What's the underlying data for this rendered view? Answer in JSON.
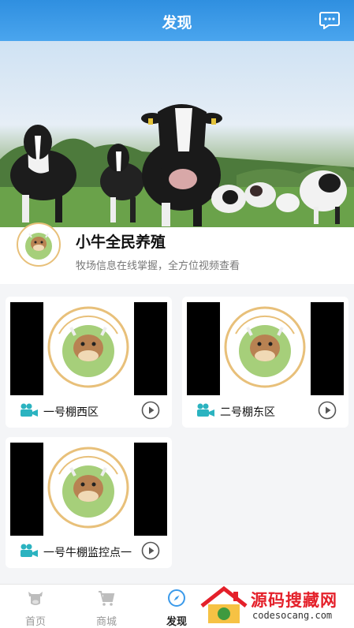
{
  "header": {
    "title": "发现",
    "chat_icon": "chat-bubble-icon",
    "color": "#3b9aea"
  },
  "profile": {
    "name": "小牛全民养殖",
    "description": "牧场信息在线掌握，全方位视频查看",
    "avatar_logo_text": "CALVES GROW FAST"
  },
  "cameras": [
    {
      "label": "一号棚西区",
      "icon": "video-camera-icon",
      "action_icon": "play-icon"
    },
    {
      "label": "二号棚东区",
      "icon": "video-camera-icon",
      "action_icon": "play-icon"
    },
    {
      "label": "一号牛棚监控点一",
      "icon": "video-camera-icon",
      "action_icon": "play-icon"
    }
  ],
  "tabs": [
    {
      "label": "首页",
      "icon": "cow-head-icon",
      "active": false
    },
    {
      "label": "商城",
      "icon": "cart-icon",
      "active": false
    },
    {
      "label": "发现",
      "icon": "compass-icon",
      "active": true
    }
  ],
  "watermark": {
    "title": "源码搜藏网",
    "url": "codesocang.com"
  },
  "colors": {
    "accent": "#3b9aea",
    "camera_icon": "#2bb3c0",
    "watermark_red": "#e4202a"
  }
}
